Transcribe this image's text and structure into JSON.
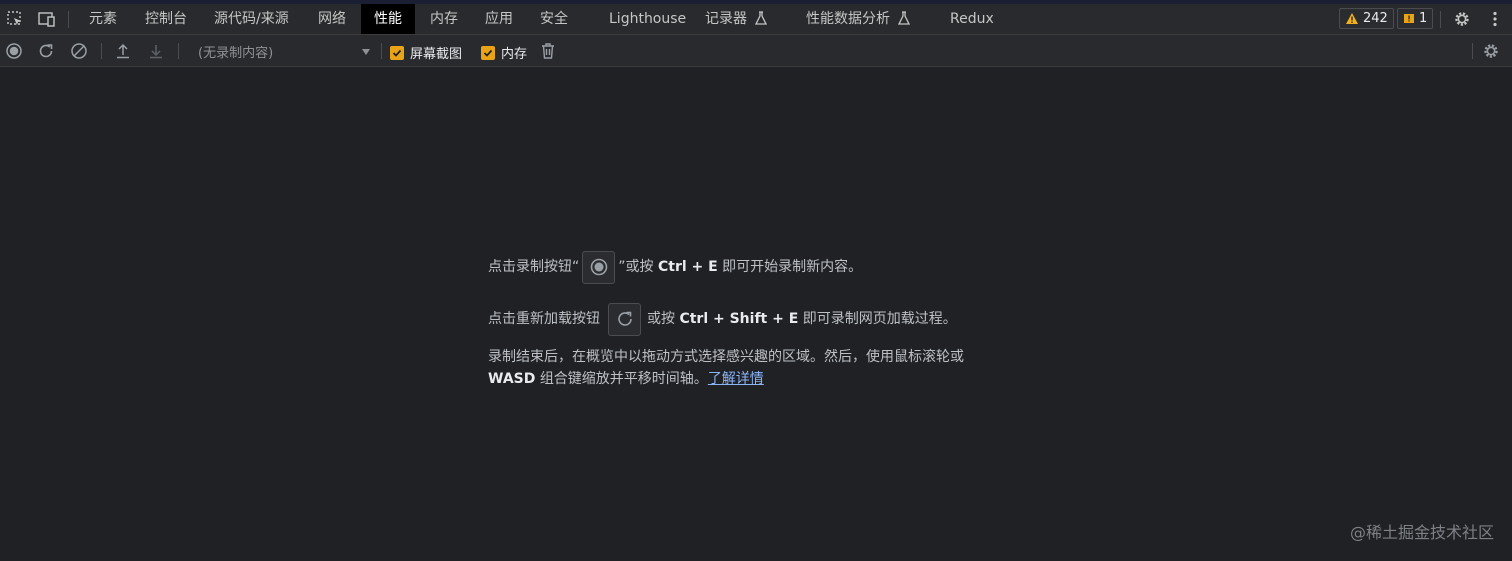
{
  "tabs": [
    "元素",
    "控制台",
    "源代码/来源",
    "网络",
    "性能",
    "内存",
    "应用",
    "安全",
    "Lighthouse",
    "记录器",
    "性能数据分析",
    "Redux"
  ],
  "active_tab": "性能",
  "issues": {
    "warnings": "242",
    "info": "1"
  },
  "toolbar": {
    "recording_select": "(无录制内容)",
    "screenshots_label": "屏幕截图",
    "memory_label": "内存"
  },
  "landing": {
    "line1_pre": "点击录制按钮“",
    "line1_post": "”或按",
    "line1_shortcut": "Ctrl + E",
    "line1_tail": "即可开始录制新内容。",
    "line2_pre": "点击重新加载按钮",
    "line2_post": "或按",
    "line2_shortcut": "Ctrl + Shift + E",
    "line2_tail": "即可录制网页加载过程。",
    "para_text": "录制结束后，在概览中以拖动方式选择感兴趣的区域。然后，使用鼠标滚轮或",
    "para_bold": "WASD",
    "para_text2": "组合键缩放并平移时间轴。",
    "learn_more": "了解详情"
  },
  "watermark": "@稀土掘金技术社区",
  "colors": {
    "background": "#202124",
    "bar": "#292a2d",
    "checkbox": "#e8a317",
    "link": "#8ab4f8",
    "active_tab_bg": "#000000"
  }
}
